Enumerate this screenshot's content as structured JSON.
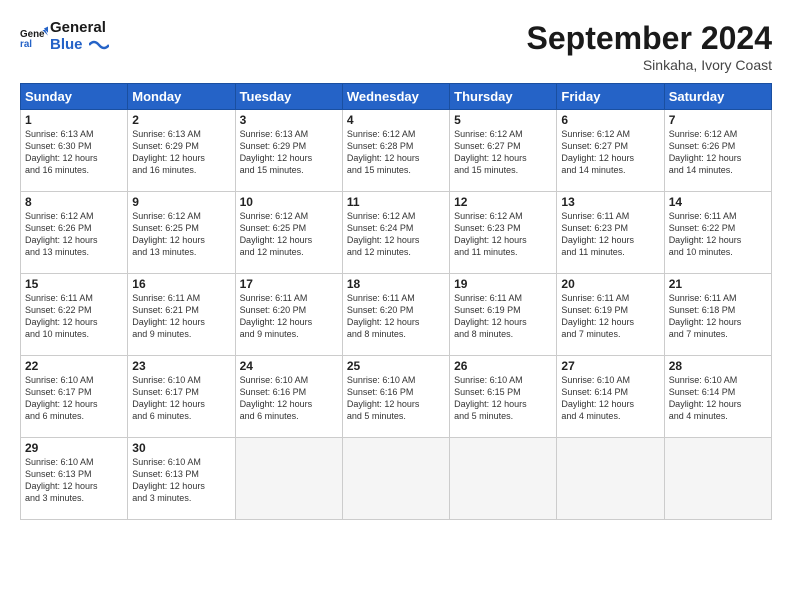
{
  "header": {
    "logo_general": "General",
    "logo_blue": "Blue",
    "month_title": "September 2024",
    "location": "Sinkaha, Ivory Coast"
  },
  "weekdays": [
    "Sunday",
    "Monday",
    "Tuesday",
    "Wednesday",
    "Thursday",
    "Friday",
    "Saturday"
  ],
  "weeks": [
    [
      {
        "day": "1",
        "lines": [
          "Sunrise: 6:13 AM",
          "Sunset: 6:30 PM",
          "Daylight: 12 hours",
          "and 16 minutes."
        ]
      },
      {
        "day": "2",
        "lines": [
          "Sunrise: 6:13 AM",
          "Sunset: 6:29 PM",
          "Daylight: 12 hours",
          "and 16 minutes."
        ]
      },
      {
        "day": "3",
        "lines": [
          "Sunrise: 6:13 AM",
          "Sunset: 6:29 PM",
          "Daylight: 12 hours",
          "and 15 minutes."
        ]
      },
      {
        "day": "4",
        "lines": [
          "Sunrise: 6:12 AM",
          "Sunset: 6:28 PM",
          "Daylight: 12 hours",
          "and 15 minutes."
        ]
      },
      {
        "day": "5",
        "lines": [
          "Sunrise: 6:12 AM",
          "Sunset: 6:27 PM",
          "Daylight: 12 hours",
          "and 15 minutes."
        ]
      },
      {
        "day": "6",
        "lines": [
          "Sunrise: 6:12 AM",
          "Sunset: 6:27 PM",
          "Daylight: 12 hours",
          "and 14 minutes."
        ]
      },
      {
        "day": "7",
        "lines": [
          "Sunrise: 6:12 AM",
          "Sunset: 6:26 PM",
          "Daylight: 12 hours",
          "and 14 minutes."
        ]
      }
    ],
    [
      {
        "day": "8",
        "lines": [
          "Sunrise: 6:12 AM",
          "Sunset: 6:26 PM",
          "Daylight: 12 hours",
          "and 13 minutes."
        ]
      },
      {
        "day": "9",
        "lines": [
          "Sunrise: 6:12 AM",
          "Sunset: 6:25 PM",
          "Daylight: 12 hours",
          "and 13 minutes."
        ]
      },
      {
        "day": "10",
        "lines": [
          "Sunrise: 6:12 AM",
          "Sunset: 6:25 PM",
          "Daylight: 12 hours",
          "and 12 minutes."
        ]
      },
      {
        "day": "11",
        "lines": [
          "Sunrise: 6:12 AM",
          "Sunset: 6:24 PM",
          "Daylight: 12 hours",
          "and 12 minutes."
        ]
      },
      {
        "day": "12",
        "lines": [
          "Sunrise: 6:12 AM",
          "Sunset: 6:23 PM",
          "Daylight: 12 hours",
          "and 11 minutes."
        ]
      },
      {
        "day": "13",
        "lines": [
          "Sunrise: 6:11 AM",
          "Sunset: 6:23 PM",
          "Daylight: 12 hours",
          "and 11 minutes."
        ]
      },
      {
        "day": "14",
        "lines": [
          "Sunrise: 6:11 AM",
          "Sunset: 6:22 PM",
          "Daylight: 12 hours",
          "and 10 minutes."
        ]
      }
    ],
    [
      {
        "day": "15",
        "lines": [
          "Sunrise: 6:11 AM",
          "Sunset: 6:22 PM",
          "Daylight: 12 hours",
          "and 10 minutes."
        ]
      },
      {
        "day": "16",
        "lines": [
          "Sunrise: 6:11 AM",
          "Sunset: 6:21 PM",
          "Daylight: 12 hours",
          "and 9 minutes."
        ]
      },
      {
        "day": "17",
        "lines": [
          "Sunrise: 6:11 AM",
          "Sunset: 6:20 PM",
          "Daylight: 12 hours",
          "and 9 minutes."
        ]
      },
      {
        "day": "18",
        "lines": [
          "Sunrise: 6:11 AM",
          "Sunset: 6:20 PM",
          "Daylight: 12 hours",
          "and 8 minutes."
        ]
      },
      {
        "day": "19",
        "lines": [
          "Sunrise: 6:11 AM",
          "Sunset: 6:19 PM",
          "Daylight: 12 hours",
          "and 8 minutes."
        ]
      },
      {
        "day": "20",
        "lines": [
          "Sunrise: 6:11 AM",
          "Sunset: 6:19 PM",
          "Daylight: 12 hours",
          "and 7 minutes."
        ]
      },
      {
        "day": "21",
        "lines": [
          "Sunrise: 6:11 AM",
          "Sunset: 6:18 PM",
          "Daylight: 12 hours",
          "and 7 minutes."
        ]
      }
    ],
    [
      {
        "day": "22",
        "lines": [
          "Sunrise: 6:10 AM",
          "Sunset: 6:17 PM",
          "Daylight: 12 hours",
          "and 6 minutes."
        ]
      },
      {
        "day": "23",
        "lines": [
          "Sunrise: 6:10 AM",
          "Sunset: 6:17 PM",
          "Daylight: 12 hours",
          "and 6 minutes."
        ]
      },
      {
        "day": "24",
        "lines": [
          "Sunrise: 6:10 AM",
          "Sunset: 6:16 PM",
          "Daylight: 12 hours",
          "and 6 minutes."
        ]
      },
      {
        "day": "25",
        "lines": [
          "Sunrise: 6:10 AM",
          "Sunset: 6:16 PM",
          "Daylight: 12 hours",
          "and 5 minutes."
        ]
      },
      {
        "day": "26",
        "lines": [
          "Sunrise: 6:10 AM",
          "Sunset: 6:15 PM",
          "Daylight: 12 hours",
          "and 5 minutes."
        ]
      },
      {
        "day": "27",
        "lines": [
          "Sunrise: 6:10 AM",
          "Sunset: 6:14 PM",
          "Daylight: 12 hours",
          "and 4 minutes."
        ]
      },
      {
        "day": "28",
        "lines": [
          "Sunrise: 6:10 AM",
          "Sunset: 6:14 PM",
          "Daylight: 12 hours",
          "and 4 minutes."
        ]
      }
    ],
    [
      {
        "day": "29",
        "lines": [
          "Sunrise: 6:10 AM",
          "Sunset: 6:13 PM",
          "Daylight: 12 hours",
          "and 3 minutes."
        ]
      },
      {
        "day": "30",
        "lines": [
          "Sunrise: 6:10 AM",
          "Sunset: 6:13 PM",
          "Daylight: 12 hours",
          "and 3 minutes."
        ]
      },
      {
        "day": "",
        "lines": []
      },
      {
        "day": "",
        "lines": []
      },
      {
        "day": "",
        "lines": []
      },
      {
        "day": "",
        "lines": []
      },
      {
        "day": "",
        "lines": []
      }
    ]
  ]
}
